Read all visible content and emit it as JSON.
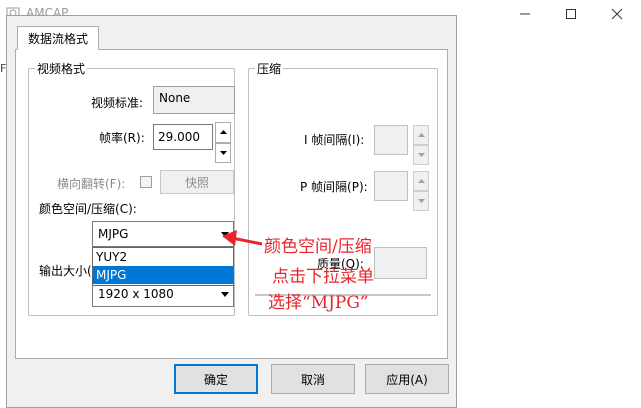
{
  "background_window": {
    "title": "AMCAP",
    "side_char": "F"
  },
  "dialog": {
    "tab_label": "数据流格式",
    "video_format": {
      "group_title": "视频格式",
      "video_standard_label": "视频标准:",
      "video_standard_value": "None",
      "frame_rate_label": "帧率(R):",
      "frame_rate_value": "29.000",
      "flip_horizontal_label": "横向翻转(F):",
      "snapshot_button": "快照",
      "color_space_label": "颜色空间/压缩(C):",
      "color_space_selected": "MJPG",
      "color_space_options": [
        "YUY2",
        "MJPG"
      ],
      "output_size_label": "输出大小(",
      "output_size_value": "1920 x 1080"
    },
    "compression": {
      "group_title": "压缩",
      "i_frame_label": "I 帧间隔(I):",
      "p_frame_label": "P 帧间隔(P):",
      "quality_label": "质量(Q):"
    },
    "buttons": {
      "ok": "确定",
      "cancel": "取消",
      "apply": "应用(A)"
    }
  },
  "annotation": {
    "line1": "颜色空间/压缩",
    "line2": "点击下拉菜单",
    "line3": "选择“MJPG”",
    "color": "#e8252b"
  },
  "colors": {
    "selection": "#0078d7",
    "dialog_bg": "#f0f0f0",
    "default_button_border": "#0078d7"
  }
}
